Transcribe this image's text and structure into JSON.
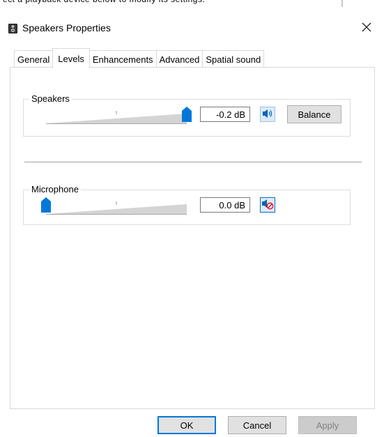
{
  "background_hint": {
    "text": "ect a playback device below to modify its settings:"
  },
  "window": {
    "title": "Speakers Properties",
    "close_glyph": "✕"
  },
  "tabs": [
    {
      "label": "General",
      "active": false
    },
    {
      "label": "Levels",
      "active": true
    },
    {
      "label": "Enhancements",
      "active": false
    },
    {
      "label": "Advanced",
      "active": false
    },
    {
      "label": "Spatial sound",
      "active": false
    }
  ],
  "levels": {
    "speakers": {
      "label": "Speakers",
      "value_text": "-0.2 dB",
      "level_fraction": 1.0,
      "muted": false,
      "balance_label": "Balance",
      "icon": "speaker-volume-icon"
    },
    "microphone": {
      "label": "Microphone",
      "value_text": "0.0 dB",
      "level_fraction": 0.0,
      "muted": true,
      "icon": "speaker-muted-icon"
    }
  },
  "footer": {
    "ok_label": "OK",
    "cancel_label": "Cancel",
    "apply_label": "Apply"
  },
  "colors": {
    "thumb": "#0078d7",
    "accent_border": "#0078d7",
    "mute_red": "#e81123"
  }
}
